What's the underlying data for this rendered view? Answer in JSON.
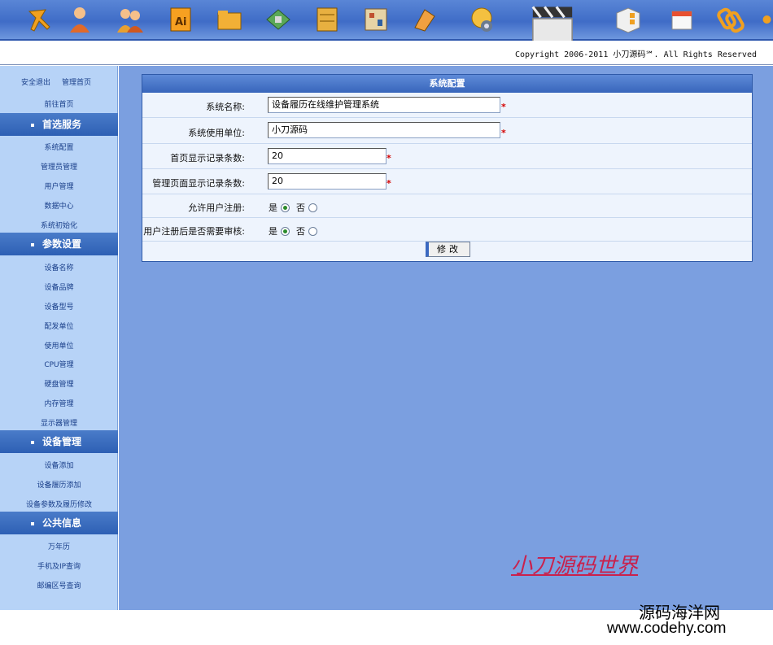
{
  "copyright": "Copyright 2006-2011 小刀源码℠. All Rights Reserved",
  "sidebar": {
    "top_links": [
      "安全退出",
      "管理首页",
      "前往首页"
    ],
    "sections": [
      {
        "title": "首选服务",
        "items": [
          "系统配置",
          "管理员管理",
          "用户管理",
          "数据中心",
          "系统初始化"
        ]
      },
      {
        "title": "参数设置",
        "items": [
          "设备名称",
          "设备品牌",
          "设备型号",
          "配发单位",
          "使用单位",
          "CPU管理",
          "硬盘管理",
          "内存管理",
          "显示器管理"
        ]
      },
      {
        "title": "设备管理",
        "items": [
          "设备添加",
          "设备履历添加",
          "设备参数及履历修改"
        ]
      },
      {
        "title": "公共信息",
        "items": [
          "万年历",
          "手机及IP查询",
          "邮编区号查询"
        ]
      }
    ]
  },
  "panel": {
    "title": "系统配置",
    "fields": [
      {
        "label": "系统名称:",
        "value": "设备履历在线维护管理系统",
        "required": "*"
      },
      {
        "label": "系统使用单位:",
        "value": "小刀源码",
        "required": "*"
      },
      {
        "label": "首页显示记录条数:",
        "value": "20",
        "required": "*"
      },
      {
        "label": "管理页面显示记录条数:",
        "value": "20",
        "required": "*"
      }
    ],
    "radios": [
      {
        "label": "允许用户注册:",
        "yes": "是",
        "no": "否",
        "selected": "yes"
      },
      {
        "label": "用户注册后是否需要审核:",
        "yes": "是",
        "no": "否",
        "selected": "yes"
      }
    ],
    "submit_label": "修改"
  },
  "watermark_brand": "小刀源码世界",
  "site_name": "源码海洋网",
  "site_url": "www.codehy.com",
  "top_icons": [
    "tools-icon",
    "user-icon",
    "users-icon",
    "illustrator-icon",
    "folder-icon",
    "chip-icon",
    "database-icon",
    "circuit-icon",
    "book-icon",
    "gallery-icon",
    "clapperboard-icon",
    "windows-icon",
    "calendar-icon",
    "link-icon",
    "globe-icon"
  ],
  "colors": {
    "accent": "#3866bb",
    "main_bg": "#7b9fe0",
    "sidebar_bg": "#b7d3f7",
    "required": "#d40000"
  }
}
